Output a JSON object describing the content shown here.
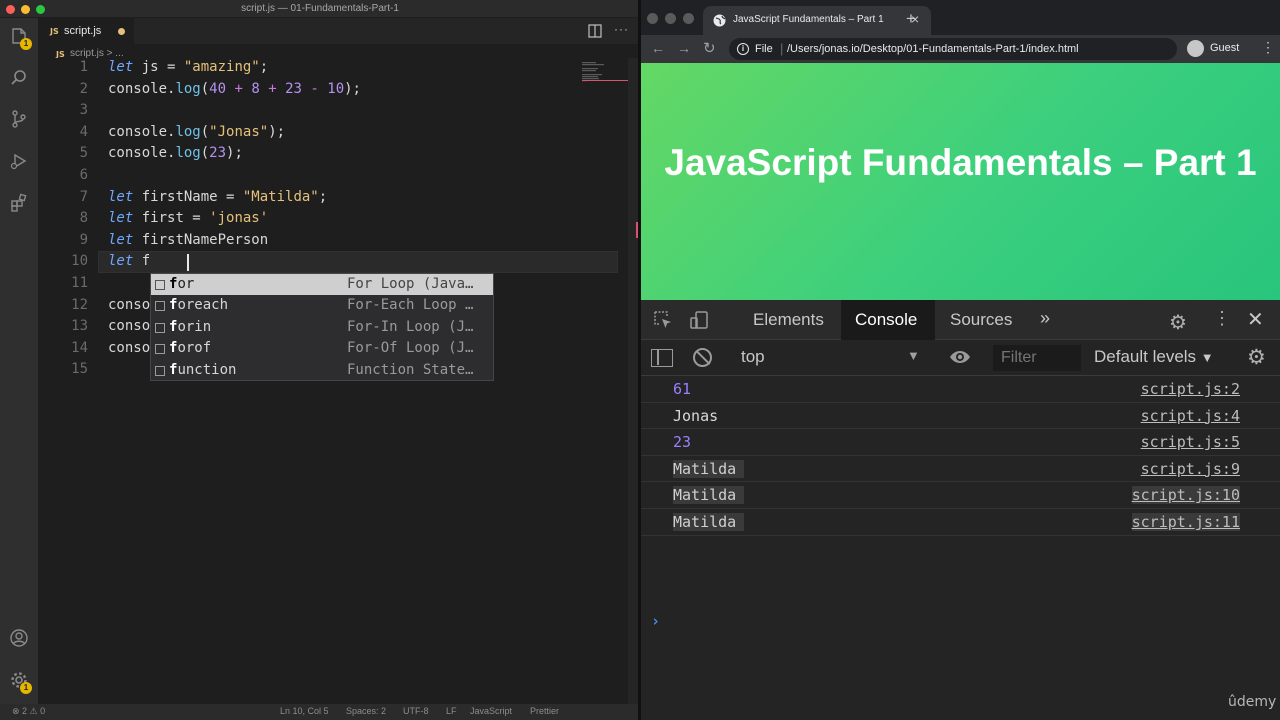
{
  "vscode": {
    "window_title": "script.js — 01-Fundamentals-Part-1",
    "tab": {
      "badge": "JS",
      "filename": "script.js"
    },
    "breadcrumb": {
      "badge": "JS",
      "text": "script.js > ..."
    },
    "badges": {
      "source_control": "1",
      "accounts": "1"
    },
    "lines": [
      {
        "n": "1",
        "html": "<span class=\"kw\">let</span> js = <span class=\"str\">\"amazing\"</span>;"
      },
      {
        "n": "2",
        "html": "console.<span class=\"fn\">log</span>(<span class=\"num\">40</span> <span class=\"op\">+</span> <span class=\"num\">8</span> <span class=\"op\">+</span> <span class=\"num\">23</span> <span class=\"op\">-</span> <span class=\"num\">10</span>);"
      },
      {
        "n": "3",
        "html": ""
      },
      {
        "n": "4",
        "html": "console.<span class=\"fn\">log</span>(<span class=\"str\">\"Jonas\"</span>);"
      },
      {
        "n": "5",
        "html": "console.<span class=\"fn\">log</span>(<span class=\"num\">23</span>);"
      },
      {
        "n": "6",
        "html": ""
      },
      {
        "n": "7",
        "html": "<span class=\"kw\">let</span> firstName = <span class=\"str\">\"Matilda\"</span>;"
      },
      {
        "n": "8",
        "html": "<span class=\"kw\">let</span> first = <span class=\"str\">'jonas'</span>"
      },
      {
        "n": "9",
        "html": "<span class=\"kw\">let</span> firstNamePerson"
      },
      {
        "n": "10",
        "html": "<span class=\"kw\">let</span> f"
      },
      {
        "n": "11",
        "html": ""
      },
      {
        "n": "12",
        "html": "conso"
      },
      {
        "n": "13",
        "html": "conso"
      },
      {
        "n": "14",
        "html": "conso"
      },
      {
        "n": "15",
        "html": ""
      }
    ],
    "suggestions": [
      {
        "match": "f",
        "rest": "or",
        "detail": "For Loop (Java…"
      },
      {
        "match": "f",
        "rest": "oreach",
        "detail": "For-Each Loop …"
      },
      {
        "match": "f",
        "rest": "orin",
        "detail": "For-In Loop (J…"
      },
      {
        "match": "f",
        "rest": "orof",
        "detail": "For-Of Loop (J…"
      },
      {
        "match": "f",
        "rest": "unction",
        "detail": "Function State…"
      }
    ],
    "status": {
      "problems": "⊗ 2 ⚠ 0",
      "position": "Ln 10, Col 5",
      "spaces": "Spaces: 2",
      "encoding": "UTF-8",
      "eol": "LF",
      "language": "JavaScript",
      "formatter": "Prettier"
    }
  },
  "browser": {
    "tab_title": "JavaScript Fundamentals – Part 1",
    "url_scheme": "File",
    "url": "/Users/jonas.io/Desktop/01-Fundamentals-Part-1/index.html",
    "profile": "Guest",
    "page_heading": "JavaScript Fundamentals – Part 1"
  },
  "devtools": {
    "tabs": [
      "Elements",
      "Console",
      "Sources"
    ],
    "active_tab": "Console",
    "context": "top",
    "filter_placeholder": "Filter",
    "levels": "Default levels",
    "messages": [
      {
        "value": "61",
        "kind": "num",
        "source": "script.js:2"
      },
      {
        "value": "Jonas",
        "kind": "txt",
        "source": "script.js:4"
      },
      {
        "value": "23",
        "kind": "num",
        "source": "script.js:5"
      },
      {
        "value": "Matilda",
        "kind": "boxed",
        "source": "script.js:9"
      },
      {
        "value": "Matilda",
        "kind": "boxed",
        "source": "script.js:10"
      },
      {
        "value": "Matilda",
        "kind": "boxed",
        "source": "script.js:11"
      }
    ],
    "prompt": "›"
  },
  "watermark": "ûdemy"
}
